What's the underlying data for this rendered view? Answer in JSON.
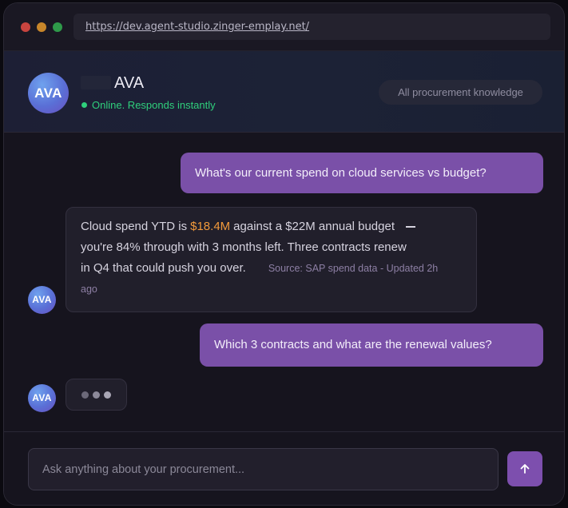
{
  "browser": {
    "url": "https://dev.agent-studio.zinger-emplay.net/"
  },
  "header": {
    "avatar_initials": "AVA",
    "agent_name": "AVA",
    "status_text": "Online. Responds instantly",
    "status_color": "#2fcf7c",
    "knowledge_label": "All procurement knowledge"
  },
  "messages": {
    "user_1": "What's our current spend on cloud services vs budget?",
    "bot_1": {
      "avatar_initials": "AVA",
      "text_before": "Cloud spend YTD is",
      "highlight": "$18.4M",
      "text_after_1": "against a $22M annual budget",
      "text_line_2": "you're 84% through with 3 months left. Three contracts renew",
      "text_line_3": "in Q4 that could push you over.",
      "source_head": "Source: SAP spend data - Updated 2h",
      "source_tail": "ago"
    },
    "user_2": "Which 3 contracts and what are the renewal values?",
    "typing_avatar_initials": "AVA"
  },
  "composer": {
    "placeholder": "Ask anything about your procurement...",
    "send_icon": "arrow-up-icon"
  },
  "colors": {
    "user_bubble": "#7a50a8",
    "highlight": "#f29a3b",
    "send_button": "#7d4fae"
  }
}
